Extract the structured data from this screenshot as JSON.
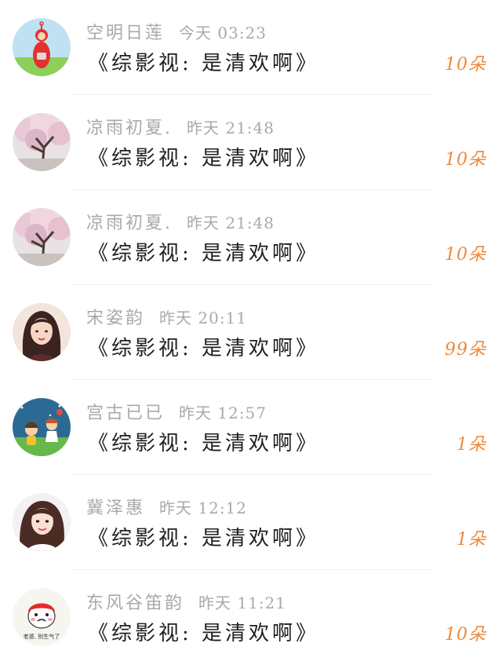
{
  "gift_list": {
    "items": [
      {
        "avatar": "teletubby-avatar",
        "user_name": "空明日莲",
        "time": "今天 03:23",
        "message": "《综影视: 是清欢啊》",
        "gift_count": "10朵"
      },
      {
        "avatar": "cherry-tree-avatar",
        "user_name": "凉雨初夏.",
        "time": "昨天 21:48",
        "message": "《综影视: 是清欢啊》",
        "gift_count": "10朵"
      },
      {
        "avatar": "cherry-tree-avatar",
        "user_name": "凉雨初夏.",
        "time": "昨天 21:48",
        "message": "《综影视: 是清欢啊》",
        "gift_count": "10朵"
      },
      {
        "avatar": "girl-portrait-avatar",
        "user_name": "宋姿韵",
        "time": "昨天 20:11",
        "message": "《综影视: 是清欢啊》",
        "gift_count": "99朵"
      },
      {
        "avatar": "cartoon-kids-avatar",
        "user_name": "宫古已已",
        "time": "昨天 12:57",
        "message": "《综影视: 是清欢啊》",
        "gift_count": "1朵"
      },
      {
        "avatar": "girl-selfie-avatar",
        "user_name": "冀泽惠",
        "time": "昨天 12:12",
        "message": "《综影视: 是清欢啊》",
        "gift_count": "1朵"
      },
      {
        "avatar": "sticker-face-avatar",
        "avatar_caption": "老婆, 别生气了",
        "user_name": "东风谷笛韵",
        "time": "昨天 11:21",
        "message": "《综影视: 是清欢啊》",
        "gift_count": "10朵"
      }
    ]
  },
  "colors": {
    "username": "#a9a9a9",
    "message": "#1f1f1f",
    "gift_count": "#ee8a3c"
  }
}
